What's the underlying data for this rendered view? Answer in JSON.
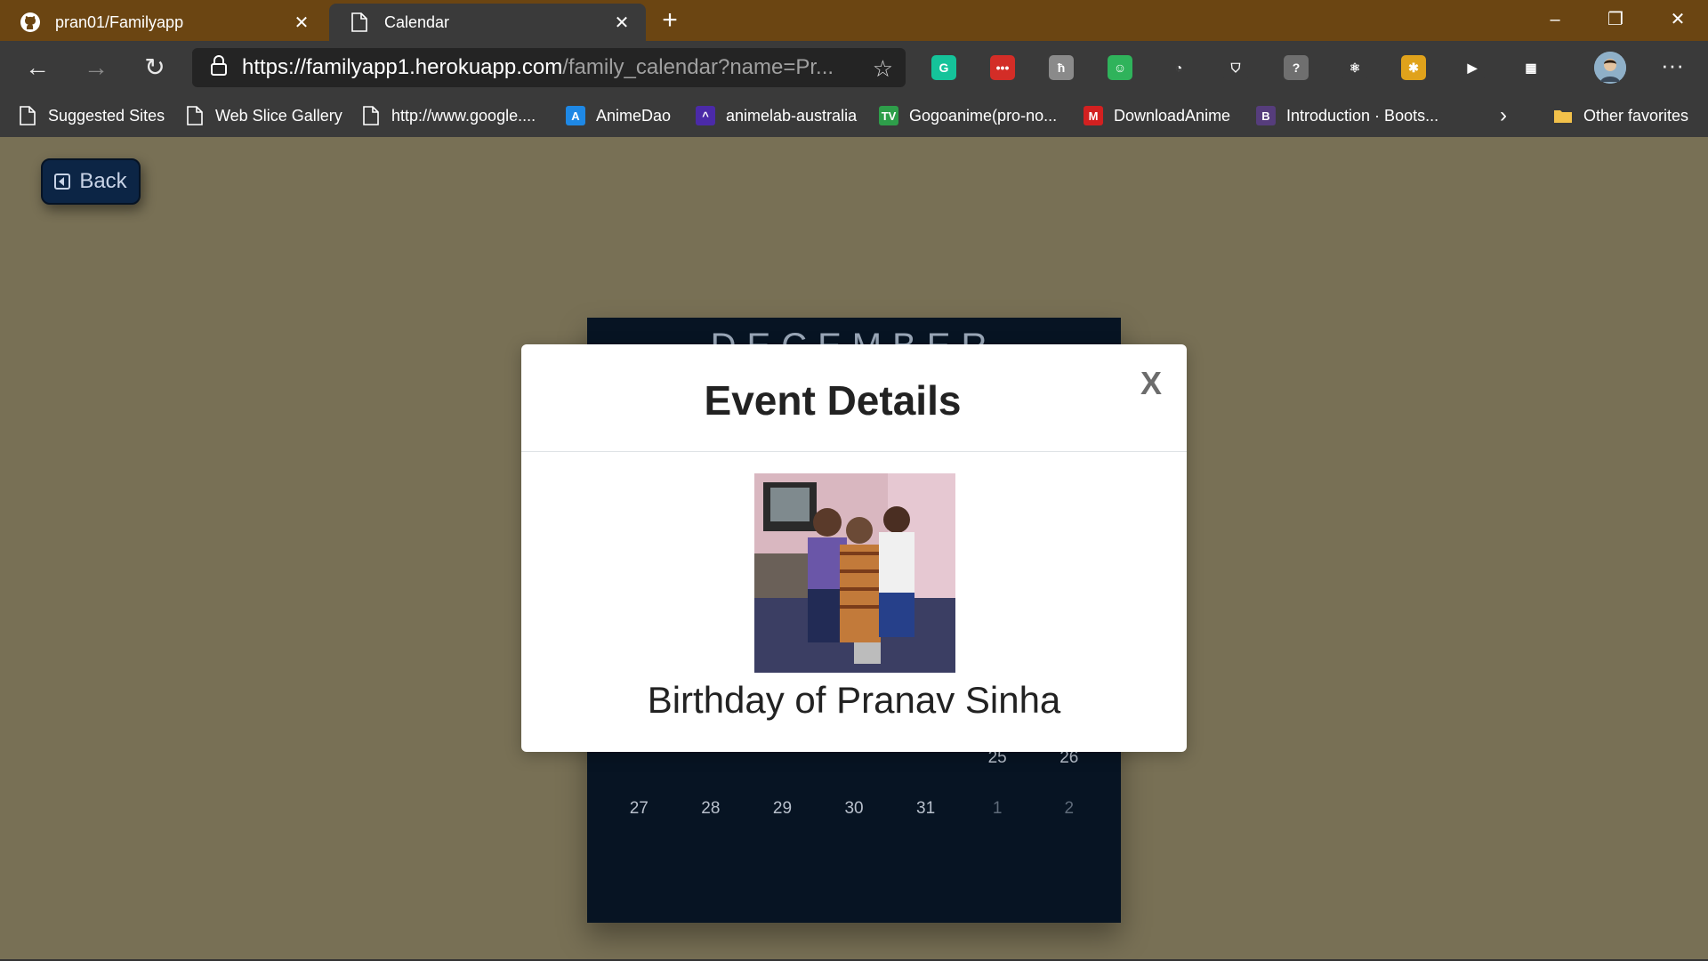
{
  "browser": {
    "tabs": [
      {
        "label": "pran01/Familyapp",
        "icon": "github-icon",
        "active": false
      },
      {
        "label": "Calendar",
        "icon": "page-icon",
        "active": true
      }
    ],
    "new_tab": "+",
    "window_controls": {
      "minimize": "–",
      "restore": "❐",
      "close": "✕"
    },
    "address": {
      "prefix": "https://",
      "host": "familyapp1.herokuapp.com",
      "path": "/family_calendar?name=Pr..."
    },
    "nav": {
      "back": "←",
      "forward": "→",
      "refresh": "↻"
    },
    "favorite_star": "☆",
    "more": "···",
    "extensions": [
      {
        "name": "grammarly-icon",
        "glyph": "G",
        "color": "#15c39a"
      },
      {
        "name": "lastpass-icon",
        "glyph": "•••",
        "color": "#d32d27"
      },
      {
        "name": "extension-h-icon",
        "glyph": "ħ",
        "color": "#8a8a8a"
      },
      {
        "name": "extension-green-icon",
        "glyph": "☺",
        "color": "#2fb35b"
      },
      {
        "name": "speedometer-icon",
        "glyph": "◔",
        "color": "#3a3a3a"
      },
      {
        "name": "shield-icon",
        "glyph": "⛉",
        "color": "#3a3a3a"
      },
      {
        "name": "unknown-extension-icon",
        "glyph": "?",
        "color": "#6f6f6f"
      },
      {
        "name": "react-devtools-icon",
        "glyph": "⚛",
        "color": "#3a3a3a"
      },
      {
        "name": "colorful-extension-icon",
        "glyph": "✱",
        "color": "#e0a21b"
      },
      {
        "name": "play-icon",
        "glyph": "▶",
        "color": "#3a3a3a"
      },
      {
        "name": "grid-extension-icon",
        "glyph": "▦",
        "color": "#3a3a3a"
      }
    ]
  },
  "bookmarks": {
    "items": [
      {
        "label": "Suggested Sites",
        "icon": "page-icon",
        "glyph": "",
        "color": ""
      },
      {
        "label": "Web Slice Gallery",
        "icon": "page-icon",
        "glyph": "",
        "color": ""
      },
      {
        "label": "http://www.google....",
        "icon": "page-icon",
        "glyph": "",
        "color": ""
      },
      {
        "label": "AnimeDao",
        "icon": "animedao-icon",
        "glyph": "A",
        "color": "#1e88e5"
      },
      {
        "label": "animelab-australia",
        "icon": "animelab-icon",
        "glyph": "^",
        "color": "#4b2aa8"
      },
      {
        "label": "Gogoanime(pro-no...",
        "icon": "gogoanime-icon",
        "glyph": "TV",
        "color": "#2e9e4a"
      },
      {
        "label": "DownloadAnime",
        "icon": "downloadanime-icon",
        "glyph": "M",
        "color": "#d32020"
      },
      {
        "label": "Introduction · Boots...",
        "icon": "bootstrap-icon",
        "glyph": "B",
        "color": "#563d7c"
      }
    ],
    "overflow": "›",
    "other_favorites": "Other favorites"
  },
  "page": {
    "back_label": "Back",
    "calendar": {
      "month": "DECEMBER",
      "partial_row": [
        "",
        "",
        "",
        "",
        "",
        "25",
        "26"
      ],
      "last_row": [
        {
          "day": "27",
          "muted": false
        },
        {
          "day": "28",
          "muted": false
        },
        {
          "day": "29",
          "muted": false
        },
        {
          "day": "30",
          "muted": false
        },
        {
          "day": "31",
          "muted": false
        },
        {
          "day": "1",
          "muted": true
        },
        {
          "day": "2",
          "muted": true
        }
      ]
    },
    "modal": {
      "title": "Event Details",
      "close": "X",
      "event_name": "Birthday of Pranav Sinha"
    }
  }
}
